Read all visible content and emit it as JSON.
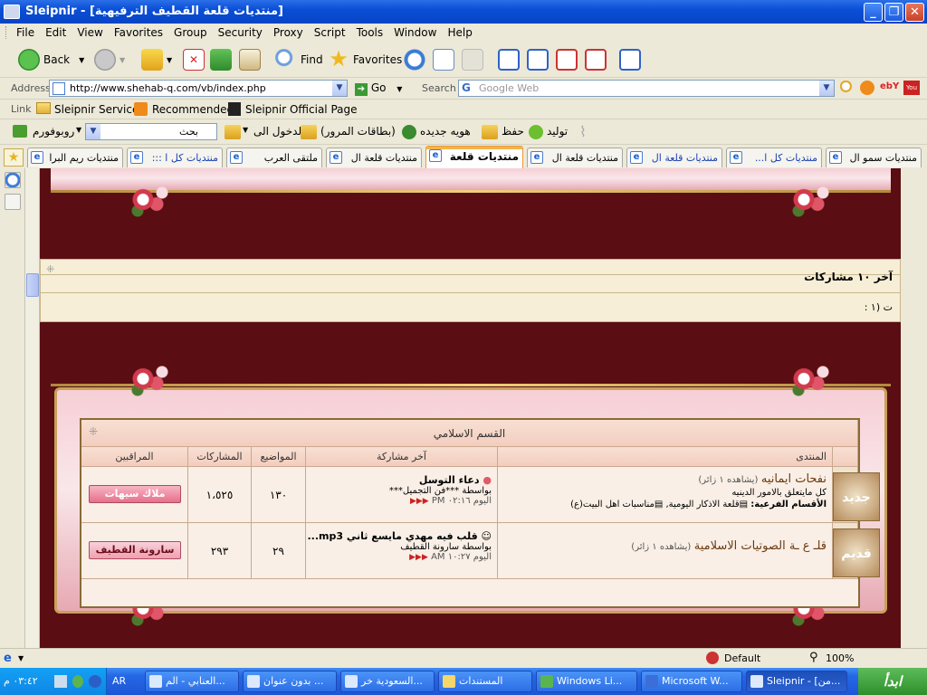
{
  "window": {
    "title": "Sleipnir - [منتديات قلعة القطيف الترفيهية]"
  },
  "menu": [
    "File",
    "Edit",
    "View",
    "Favorites",
    "Group",
    "Security",
    "Proxy",
    "Script",
    "Tools",
    "Window",
    "Help"
  ],
  "toolbar": {
    "back": "Back",
    "find": "Find",
    "favorites": "Favorites"
  },
  "address": {
    "label": "Address",
    "url": "http://www.shehab-q.com/vb/index.php",
    "go": "Go",
    "search_label": "Search",
    "search_placeholder": "Google Web"
  },
  "links": {
    "label": "Link",
    "items": [
      "Sleipnir Services",
      "Recommended",
      "Sleipnir Official Page"
    ]
  },
  "ext_toolbar": {
    "brand": "روبوفورم",
    "search_value": "بحث",
    "items": [
      "الدخول الى",
      "(بطاقات المرور)",
      "هويه جديده",
      "حفظ",
      "توليد"
    ]
  },
  "tabs": [
    "منتديات سمو ال",
    "منتديات كل ا...",
    "منتديات قلعة ال",
    "منتديات قلعة ال",
    "منتديات قلعة",
    "منتديات قلعة ال",
    "ملتقى العرب",
    "منتديات كل ا ::: ",
    "منتديات ريم البرا"
  ],
  "stats": {
    "header": "آخر ١٠ مشاركات",
    "subline": "ت (١ :"
  },
  "forum": {
    "section_title": "القسم الاسلامي",
    "columns": {
      "forum": "المنتدى",
      "last_post": "آخر مشاركة",
      "threads": "المواضيع",
      "posts": "المشاركات",
      "moderators": "المراقبين"
    },
    "rows": [
      {
        "title": "نفحات ايمانيه",
        "viewers": "(يشاهده ١ زائر)",
        "description": "كل مايتعلق بالامور الدينيه",
        "subforums_label": "الأقسام الفرعية:",
        "subforums": [
          "قلعة الاذكار اليومية,",
          "مناسبات اهل البيت(ع)"
        ],
        "icon_text": "جديد",
        "last_post_title": "دعاء التوسل",
        "last_post_by": "بواسطة ***فن التجميل***",
        "last_post_time": "اليوم ٠٢:١٦ PM",
        "threads": "١٣٠",
        "posts": "١،٥٢٥",
        "moderator": "ملاك سيهات"
      },
      {
        "title": "قلـ ع ـة الصوتيات الاسلامية",
        "viewers": "(يشاهده ١ زائر)",
        "description": "",
        "icon_text": "قديم",
        "last_post_title": "قلب فيه مهدي مايسع ثاني mp3...",
        "last_post_by": "بواسطة سارونة القطيف",
        "last_post_time": "اليوم ١٠:٢٧ AM",
        "threads": "٢٩",
        "posts": "٢٩٣",
        "moderator": "سارونة القطيف"
      }
    ]
  },
  "statusbar": {
    "proxy": "Default",
    "zoom": "100%"
  },
  "taskbar": {
    "start": "ابدأ",
    "time": "٠٣:٤٢ م",
    "lang": "AR",
    "buttons": [
      "Sleipnir - [من...",
      "Microsoft W...",
      "Windows Li...",
      "المستندات",
      "السعودية خر...",
      "بدون عنوان ...",
      "العنابي - الم..."
    ]
  }
}
